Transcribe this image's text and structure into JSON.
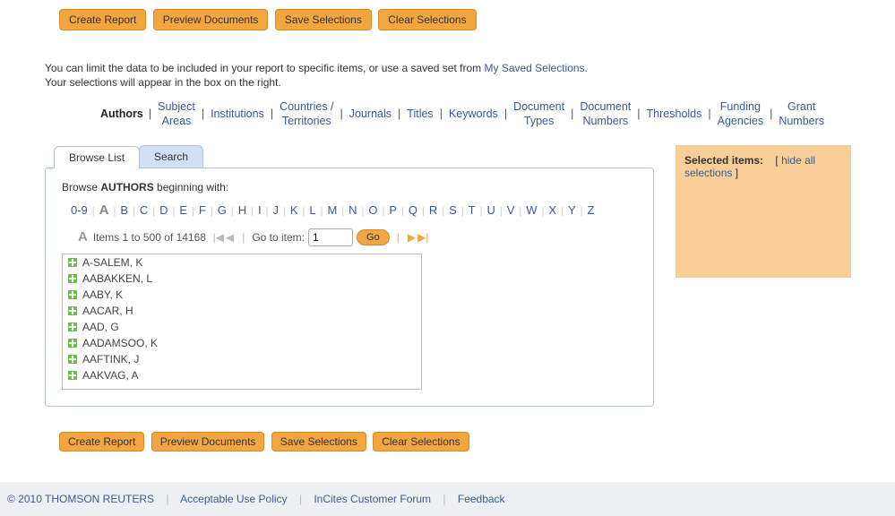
{
  "actions": {
    "create": "Create Report",
    "preview": "Preview Documents",
    "save": "Save Selections",
    "clear": "Clear Selections"
  },
  "intro": {
    "line1a": "You can limit the data to be included in your report to specific items, or use a saved set from ",
    "saved_link": "My Saved Selections",
    "line1b": ".",
    "line2": "Your selections will appear in the box on the right."
  },
  "categories": [
    "Authors",
    "Subject Areas",
    "Institutions",
    "Countries / Territories",
    "Journals",
    "Titles",
    "Keywords",
    "Document Types",
    "Document Numbers",
    "Thresholds",
    "Funding Agencies",
    "Grant Numbers"
  ],
  "current_category_index": 0,
  "tabs": {
    "browse": "Browse List",
    "search": "Search"
  },
  "browse": {
    "prefix": "Browse ",
    "subject": "AUTHORS",
    "suffix": " beginning with:",
    "alpha_first": "0-9",
    "alpha_current": "A",
    "letters": [
      "B",
      "C",
      "D",
      "E",
      "F",
      "G",
      "H",
      "I",
      "J",
      "K",
      "L",
      "M",
      "N",
      "O",
      "P",
      "Q",
      "R",
      "S",
      "T",
      "U",
      "V",
      "W",
      "X",
      "Y",
      "Z"
    ]
  },
  "pager": {
    "letter": "A",
    "summary": "Items 1 to 500 of 14168",
    "go_label": "Go to item:",
    "go_value": "1",
    "go_btn": "Go"
  },
  "authors": [
    "A-SALEM, K",
    "AABAKKEN, L",
    "AABY, K",
    "AACAR, H",
    "AAD, G",
    "AADAMSOO, K",
    "AAFTINK, J",
    "AAKVAG, A"
  ],
  "selected": {
    "title": "Selected items:",
    "hide_a": "[ ",
    "hide_link": "hide all selections",
    "hide_b": " ]"
  },
  "footer": {
    "copyright": "© 2010 THOMSON REUTERS",
    "aup": "Acceptable Use Policy",
    "forum": "InCites Customer Forum",
    "feedback": "Feedback"
  }
}
